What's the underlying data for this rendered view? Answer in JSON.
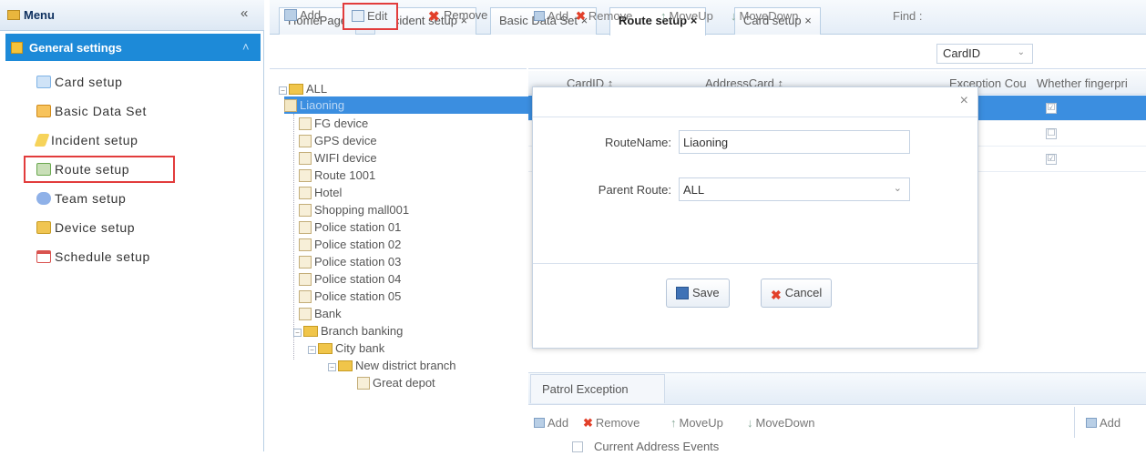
{
  "menu": {
    "title": "Menu",
    "collapse_icon": "«",
    "group_label": "General settings",
    "group_toggle": "˄",
    "items": [
      {
        "label": "Card setup",
        "icon": "card-icon",
        "color": "#7fb3e6"
      },
      {
        "label": "Basic Data Set",
        "icon": "data-icon",
        "color": "#f0a12a"
      },
      {
        "label": "Incident setup",
        "icon": "lightning-icon",
        "color": "#f2b01e"
      },
      {
        "label": "Route setup",
        "icon": "route-icon",
        "color": "#6aa84f"
      },
      {
        "label": "Team setup",
        "icon": "team-icon",
        "color": "#6a8fd8"
      },
      {
        "label": "Device setup",
        "icon": "device-icon",
        "color": "#e9b63d"
      },
      {
        "label": "Schedule setup",
        "icon": "calendar-icon",
        "color": "#d9534f"
      }
    ]
  },
  "tabs": [
    {
      "label": "HomePage",
      "closable": false
    },
    {
      "label": "Incident setup ×",
      "closable": true
    },
    {
      "label": "Basic Data Set ×",
      "closable": true
    },
    {
      "label": "Route setup ×",
      "closable": true,
      "active": true
    },
    {
      "label": "Card setup ×",
      "closable": true
    }
  ],
  "tree_toolbar": {
    "add": "Add",
    "edit": "Edit",
    "remove": "Remove"
  },
  "tree": {
    "root": "ALL",
    "selected": "Liaoning",
    "nodes": [
      "FG device",
      "GPS device",
      "WIFI device",
      "Route 1001",
      "Hotel",
      "Shopping mall001",
      "Police station 01",
      "Police station 02",
      "Police station 03",
      "Police station 04",
      "Police station 05",
      "Bank"
    ],
    "branch": "Branch banking",
    "city": "City bank",
    "district": "New district branch",
    "depot": "Great depot"
  },
  "grid_toolbar": {
    "add": "Add",
    "remove": "Remove",
    "move_up": "MoveUp",
    "move_down": "MoveDown",
    "find": "Find :",
    "find_value": "CardID"
  },
  "grid_columns": {
    "card_id": "CardID ↕",
    "address_card": "AddressCard ↕",
    "exception": "Exception Cou",
    "fingerprint": "Whether fingerpri"
  },
  "grid_checks": [
    "☑",
    "☐",
    "☑"
  ],
  "patrol_exception": {
    "tab": "Patrol Exception",
    "add": "Add",
    "remove": "Remove",
    "move_up": "MoveUp",
    "move_down": "MoveDown",
    "right_add": "Add",
    "row_label": "Current Address Events"
  },
  "modal": {
    "close": "×",
    "route_name_label": "RouteName:",
    "route_name_value": "Liaoning",
    "parent_label": "Parent Route:",
    "parent_value": "ALL",
    "save": "Save",
    "cancel": "Cancel"
  }
}
